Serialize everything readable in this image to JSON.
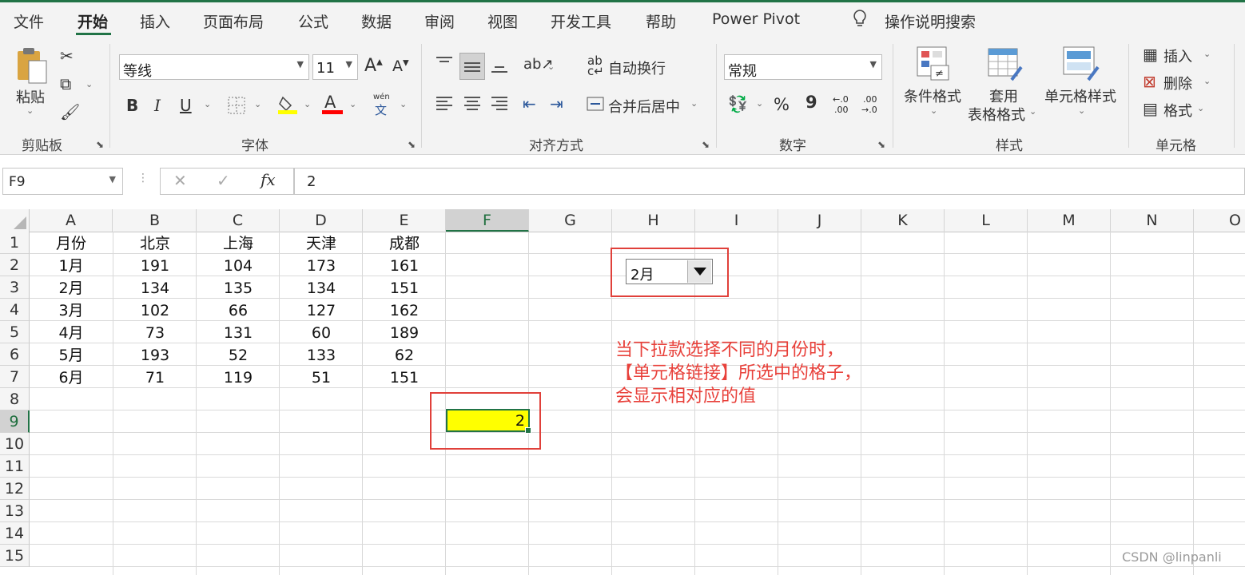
{
  "tabs": [
    "文件",
    "开始",
    "插入",
    "页面布局",
    "公式",
    "数据",
    "审阅",
    "视图",
    "开发工具",
    "帮助",
    "Power Pivot"
  ],
  "tell_me": "操作说明搜索",
  "clipboard": {
    "paste": "粘贴",
    "label": "剪贴板"
  },
  "font": {
    "name": "等线",
    "size": "11",
    "label": "字体",
    "bold": "B",
    "italic": "I",
    "underline": "U",
    "grow": "A",
    "shrink": "A",
    "color_letter": "A",
    "phonetic_top": "wén",
    "phonetic_bottom": "文",
    "highlight_color": "#ffff00",
    "font_color": "#ff0000"
  },
  "alignment": {
    "wrap": "自动换行",
    "merge": "合并后居中",
    "label": "对齐方式"
  },
  "number": {
    "format": "常规",
    "label": "数字",
    "percent": "%",
    "comma": "9",
    "inc_decimal_top": "←.0",
    "inc_decimal_bottom": ".00",
    "dec_decimal_top": ".00",
    "dec_decimal_bottom": "→.0"
  },
  "styles": {
    "conditional": "条件格式",
    "table_1": "套用",
    "table_2": "表格格式",
    "cell_styles": "单元格样式",
    "label": "样式"
  },
  "cells": {
    "insert": "插入",
    "delete": "删除",
    "format": "格式",
    "label": "单元格"
  },
  "formula_bar": {
    "name_box": "F9",
    "fx": "fx",
    "value": "2"
  },
  "columns": [
    "A",
    "B",
    "C",
    "D",
    "E",
    "F",
    "G",
    "H",
    "I",
    "J",
    "K",
    "L",
    "M",
    "N",
    "O"
  ],
  "rows": [
    "1",
    "2",
    "3",
    "4",
    "5",
    "6",
    "7",
    "8",
    "9",
    "10",
    "11",
    "12",
    "13",
    "14",
    "15"
  ],
  "table": [
    [
      "月份",
      "北京",
      "上海",
      "天津",
      "成都"
    ],
    [
      "1月",
      "191",
      "104",
      "173",
      "161"
    ],
    [
      "2月",
      "134",
      "135",
      "134",
      "151"
    ],
    [
      "3月",
      "102",
      "66",
      "127",
      "162"
    ],
    [
      "4月",
      "73",
      "131",
      "60",
      "189"
    ],
    [
      "5月",
      "193",
      "52",
      "133",
      "62"
    ],
    [
      "6月",
      "71",
      "119",
      "51",
      "151"
    ]
  ],
  "dropdown": {
    "value": "2月"
  },
  "linked_cell": {
    "value": "2",
    "fill": "#ffff00"
  },
  "note": [
    "当下拉款选择不同的月份时，",
    "【单元格链接】所选中的格子，",
    "会显示相对应的值"
  ],
  "watermark": "CSDN @linpanli",
  "colors": {
    "accent": "#217346",
    "annotation": "#e8403a"
  }
}
